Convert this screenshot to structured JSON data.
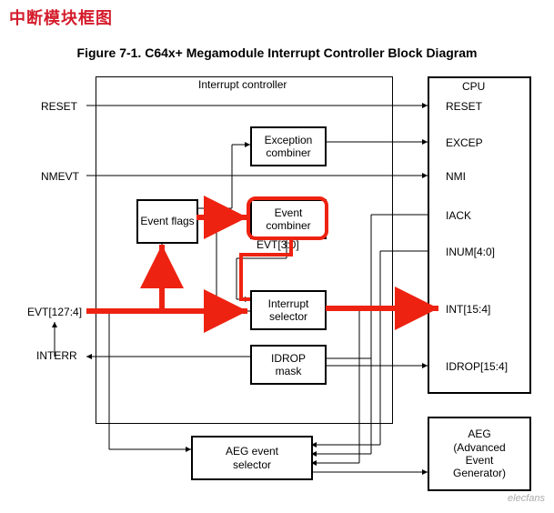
{
  "header": "中断模块框图",
  "figure_title": "Figure 7-1.  C64x+ Megamodule Interrupt Controller Block Diagram",
  "outer_box": {
    "title": "Interrupt controller"
  },
  "cpu_box": {
    "title": "CPU"
  },
  "left_signals": {
    "reset": "RESET",
    "nmevt": "NMEVT",
    "evt": "EVT[127:4]",
    "interr": "INTERR"
  },
  "right_signals": {
    "reset": "RESET",
    "excep": "EXCEP",
    "nmi": "NMI",
    "iack": "IACK",
    "inum": "INUM[4:0]",
    "int": "INT[15:4]",
    "idrop": "IDROP[15:4]"
  },
  "blocks": {
    "evt_flags": "Event flags",
    "exc_comb_l1": "Exception",
    "exc_comb_l2": "combiner",
    "evt_comb_l1": "Event",
    "evt_comb_l2": "combiner",
    "int_sel_l1": "Interrupt",
    "int_sel_l2": "selector",
    "idrop_l1": "IDROP",
    "idrop_l2": "mask",
    "aeg_sel_l1": "AEG event",
    "aeg_sel_l2": "selector",
    "aeg_box_l1": "AEG",
    "aeg_box_l2": "(Advanced",
    "aeg_box_l3": "Event",
    "aeg_box_l4": "Generator)"
  },
  "bus_label": "EVT[3:0]",
  "watermark": "elecfans"
}
